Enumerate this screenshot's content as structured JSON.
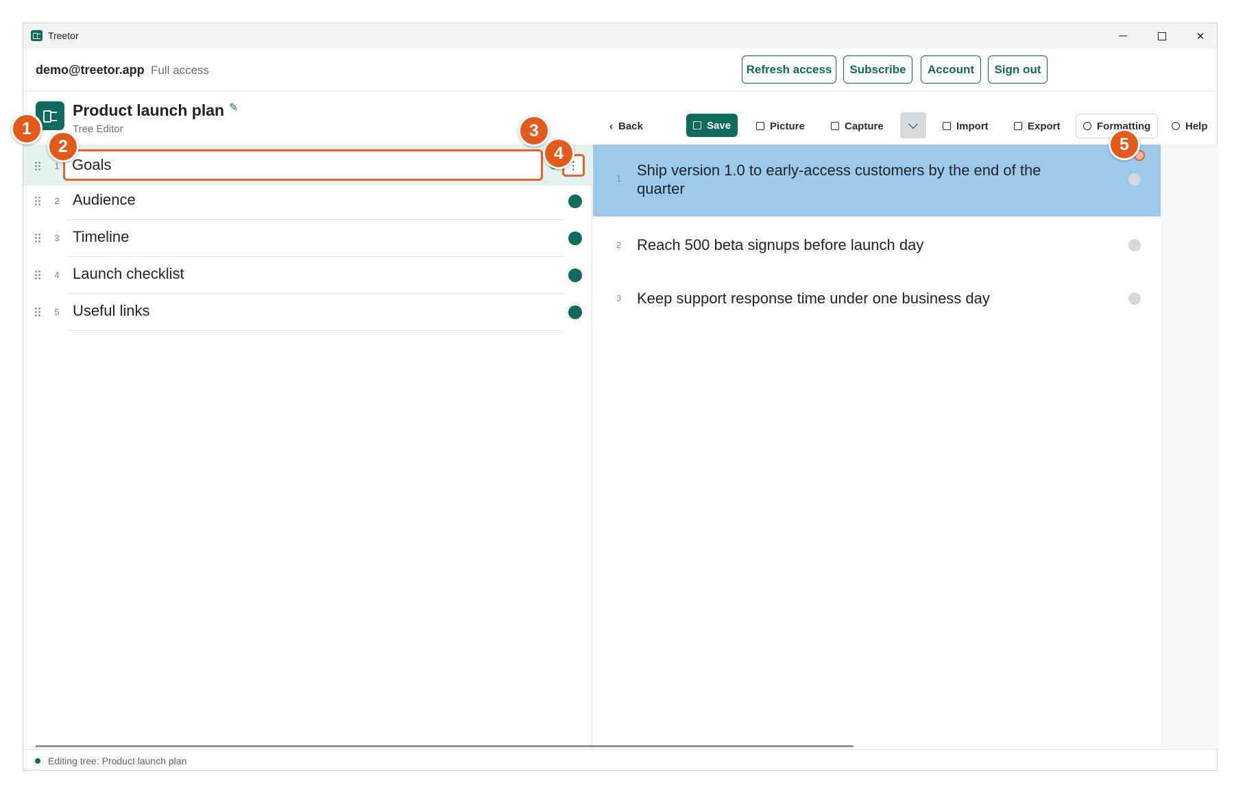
{
  "window": {
    "app_title": "Treetor"
  },
  "topbar": {
    "email": "demo@treetor.app",
    "access": "Full access",
    "buttons": {
      "refresh": "Refresh access",
      "subscribe": "Subscribe",
      "account": "Account",
      "sign_out": "Sign out"
    }
  },
  "tree": {
    "title": "Product launch plan",
    "subtitle": "Tree Editor"
  },
  "toolbar": {
    "back": "Back",
    "save": "Save",
    "picture": "Picture",
    "capture": "Capture",
    "import": "Import",
    "export": "Export",
    "formatting": "Formatting",
    "help": "Help"
  },
  "nodes": [
    {
      "num": "1",
      "label": "Goals"
    },
    {
      "num": "2",
      "label": "Audience"
    },
    {
      "num": "3",
      "label": "Timeline"
    },
    {
      "num": "4",
      "label": "Launch checklist"
    },
    {
      "num": "5",
      "label": "Useful links"
    }
  ],
  "goals": [
    {
      "num": "1",
      "text": "Ship version 1.0 to early-access customers by the end of the quarter"
    },
    {
      "num": "2",
      "text": "Reach 500 beta signups before launch day"
    },
    {
      "num": "3",
      "text": "Keep support response time under one business day"
    }
  ],
  "status": {
    "text": "Editing tree: Product launch plan"
  },
  "callouts": [
    "1",
    "2",
    "3",
    "4",
    "5"
  ],
  "colors": {
    "brand": "#0e6b5e",
    "callout": "#e35a1b",
    "selection": "#9ec8ea"
  }
}
